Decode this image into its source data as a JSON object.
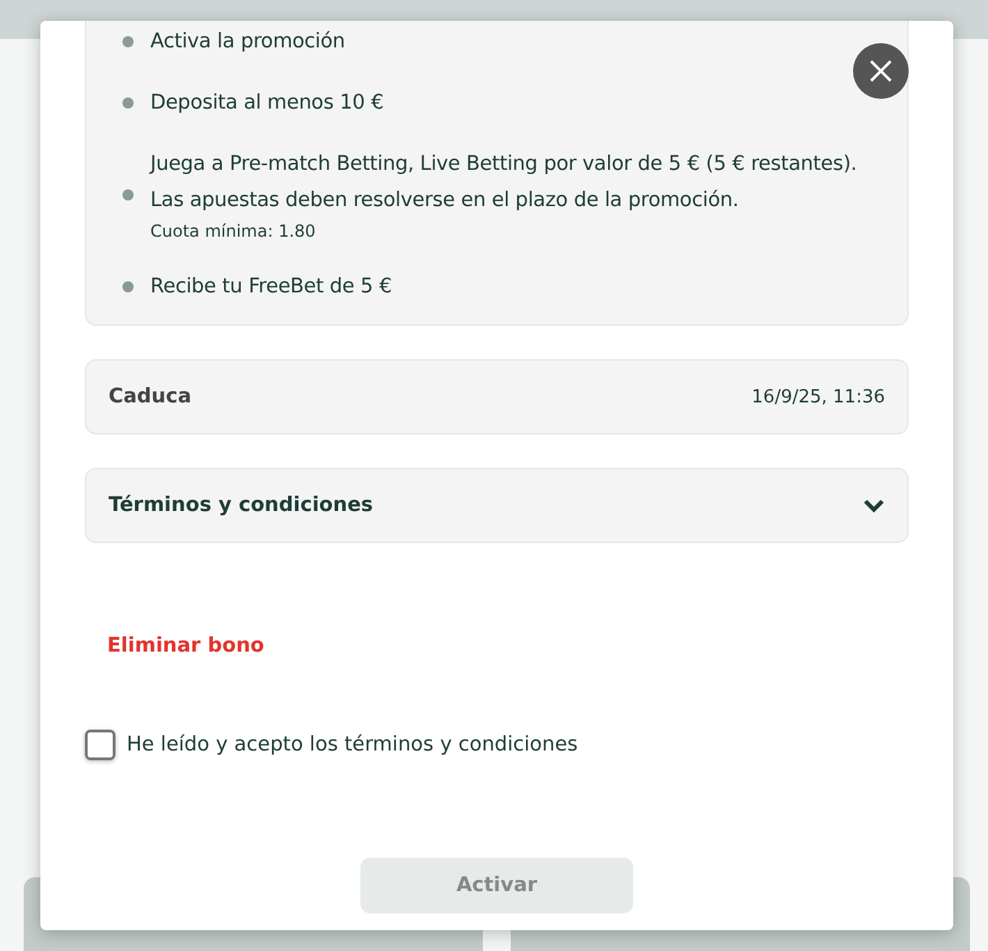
{
  "steps": [
    {
      "text": "Activa la promoción"
    },
    {
      "text": "Deposita al menos 10 €"
    },
    {
      "text": "Juega a Pre-match Betting, Live Betting por valor de 5 € (5 € restantes). Las apuestas deben resolverse en el plazo de la promoción.",
      "note": "Cuota mínima: 1.80"
    },
    {
      "text": "Recibe tu FreeBet de 5 €"
    }
  ],
  "expiry": {
    "label": "Caduca",
    "value": "16/9/25, 11:36"
  },
  "terms": {
    "label": "Términos y condiciones",
    "expanded": false
  },
  "remove_link": "Eliminar bono",
  "accept": {
    "label": "He leído y acepto los términos y condiciones",
    "checked": false
  },
  "activate_button": {
    "label": "Activar",
    "disabled": true
  }
}
